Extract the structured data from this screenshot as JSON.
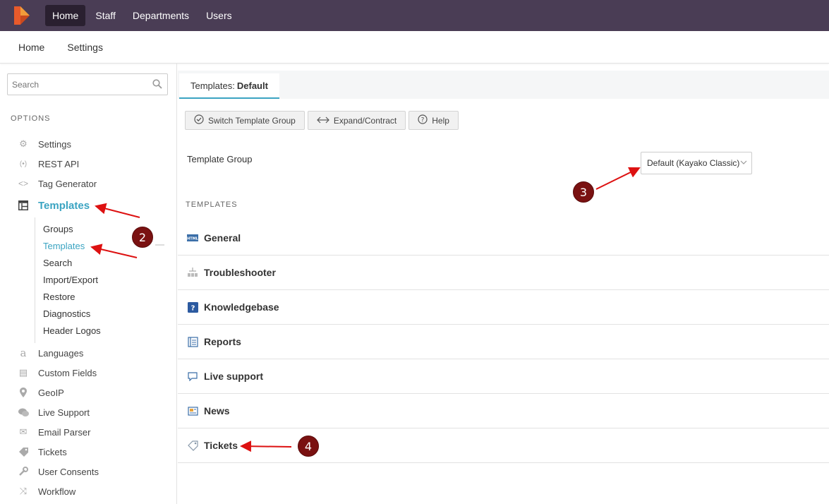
{
  "topnav": {
    "logo": "kayako-logo",
    "items": [
      {
        "label": "Home",
        "active": true
      },
      {
        "label": "Staff"
      },
      {
        "label": "Departments"
      },
      {
        "label": "Users"
      }
    ]
  },
  "subnav": {
    "items": [
      {
        "label": "Home"
      },
      {
        "label": "Settings"
      }
    ]
  },
  "sidebar": {
    "search_placeholder": "Search",
    "options_title": "OPTIONS",
    "items_top": [
      {
        "label": "Settings",
        "icon": "gear-icon"
      },
      {
        "label": "REST API",
        "icon": "broadcast-icon"
      },
      {
        "label": "Tag Generator",
        "icon": "code-icon"
      }
    ],
    "active_item": {
      "label": "Templates",
      "icon": "template-icon"
    },
    "submenu": [
      {
        "label": "Groups"
      },
      {
        "label": "Templates",
        "active": true
      },
      {
        "label": "Search"
      },
      {
        "label": "Import/Export"
      },
      {
        "label": "Restore"
      },
      {
        "label": "Diagnostics"
      },
      {
        "label": "Header Logos"
      }
    ],
    "items_bottom": [
      {
        "label": "Languages",
        "icon": "letter-a-icon"
      },
      {
        "label": "Custom Fields",
        "icon": "list-icon"
      },
      {
        "label": "GeoIP",
        "icon": "map-pin-icon"
      },
      {
        "label": "Live Support",
        "icon": "chat-icon"
      },
      {
        "label": "Email Parser",
        "icon": "envelope-icon"
      },
      {
        "label": "Tickets",
        "icon": "tag-icon"
      },
      {
        "label": "User Consents",
        "icon": "wrench-icon"
      },
      {
        "label": "Workflow",
        "icon": "shuffle-icon"
      }
    ]
  },
  "main": {
    "tab_prefix": "Templates:",
    "tab_name": "Default",
    "toolbar": {
      "switch_label": "Switch Template Group",
      "expand_label": "Expand/Contract",
      "help_label": "Help"
    },
    "template_group_label": "Template Group",
    "template_group_value": "Default (Kayako Classic)",
    "templates_title": "TEMPLATES",
    "templates": [
      {
        "label": "General",
        "icon": "html-icon"
      },
      {
        "label": "Troubleshooter",
        "icon": "troubleshooter-icon"
      },
      {
        "label": "Knowledgebase",
        "icon": "book-icon"
      },
      {
        "label": "Reports",
        "icon": "report-icon"
      },
      {
        "label": "Live support",
        "icon": "speech-bubble-icon"
      },
      {
        "label": "News",
        "icon": "newspaper-icon"
      },
      {
        "label": "Tickets",
        "icon": "tag-icon"
      }
    ]
  },
  "annotations": {
    "badges": [
      "2",
      "3",
      "4"
    ],
    "accent": "#7a1111",
    "arrow_color": "#dd1111"
  }
}
